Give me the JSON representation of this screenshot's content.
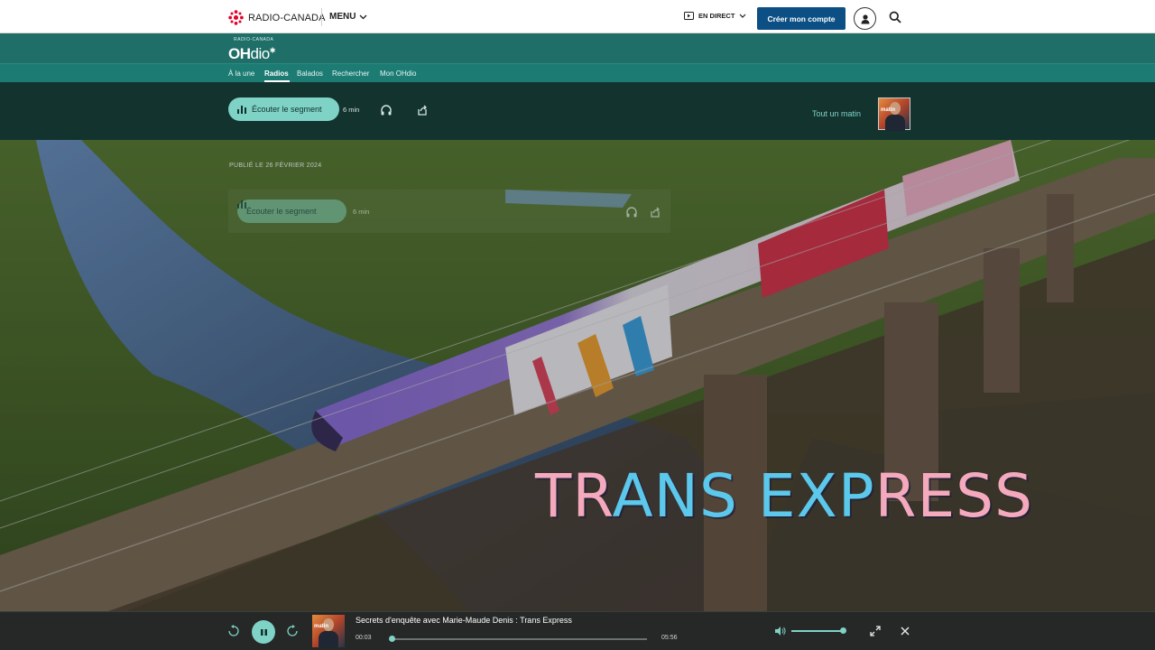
{
  "topbar": {
    "brand": "RADIO-CANADA",
    "menu_label": "MENU",
    "direct_label": "EN DIRECT",
    "create_account": "Créer mon compte",
    "brand_color": "#e4002b",
    "button_color": "#0b4f84"
  },
  "ohdio": {
    "small_brand": "RADIO-CANADA",
    "logo_bold": "OH",
    "logo_light": "dio",
    "nav": [
      {
        "label": "À la une"
      },
      {
        "label": "Radios"
      },
      {
        "label": "Balados"
      },
      {
        "label": "Rechercher"
      },
      {
        "label": "Mon OHdio"
      }
    ],
    "active_nav": "Radios",
    "accent_color": "#7fd2c6"
  },
  "segment": {
    "listen_label": "Écouter le segment",
    "duration": "6 min",
    "show_name": "Tout un matin",
    "thumb_text": "matin"
  },
  "hero": {
    "published": "PUBLIÉ LE 26 FÉVRIER 2024",
    "ghost_listen_label": "Écouter le segment",
    "ghost_duration": "6 min",
    "overlay_word1_part1": "TR",
    "overlay_word1_part2": "ANS",
    "overlay_word2_part1": "EXP",
    "overlay_word2_part2": "RESS"
  },
  "player": {
    "title": "Secrets d'enquête avec Marie-Maude Denis : Trans Express",
    "current_time": "00:03",
    "total_time": "05:56",
    "progress": 0.01,
    "volume": 0.95
  }
}
